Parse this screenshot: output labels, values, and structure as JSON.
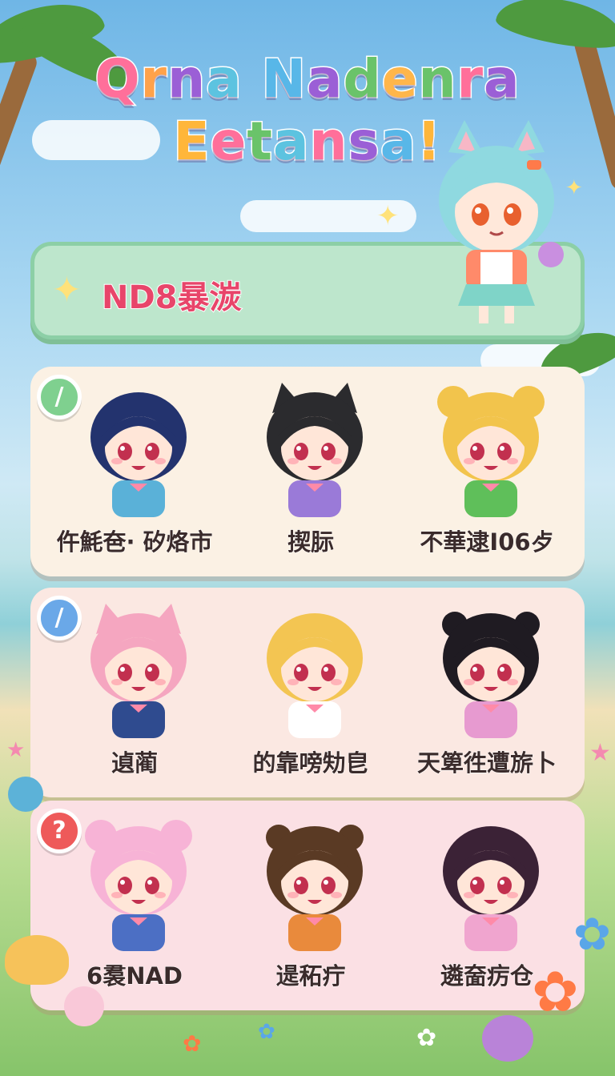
{
  "title": {
    "line1": "Qrna Nadenra",
    "line2": "Eetansa!"
  },
  "title_letters_line1": [
    {
      "ch": "Q",
      "color": "#ff6f9a"
    },
    {
      "ch": "r",
      "color": "#ffa24a"
    },
    {
      "ch": "n",
      "color": "#9b5fd6"
    },
    {
      "ch": "a",
      "color": "#5cc3e0"
    },
    {
      "ch": " ",
      "color": "#fff"
    },
    {
      "ch": "N",
      "color": "#58b7e8"
    },
    {
      "ch": "a",
      "color": "#9b5fd6"
    },
    {
      "ch": "d",
      "color": "#6ac36a"
    },
    {
      "ch": "e",
      "color": "#ffb64a"
    },
    {
      "ch": "n",
      "color": "#6ac36a"
    },
    {
      "ch": "r",
      "color": "#ff6f9a"
    },
    {
      "ch": "a",
      "color": "#9b5fd6"
    }
  ],
  "title_letters_line2": [
    {
      "ch": "E",
      "color": "#ffb63a"
    },
    {
      "ch": "e",
      "color": "#ff6f9a"
    },
    {
      "ch": "t",
      "color": "#6ac36a"
    },
    {
      "ch": "a",
      "color": "#5cc3e0"
    },
    {
      "ch": "n",
      "color": "#ff6f9a"
    },
    {
      "ch": "s",
      "color": "#9b5fd6"
    },
    {
      "ch": "a",
      "color": "#58b7e8"
    },
    {
      "ch": "!",
      "color": "#ffb63a"
    }
  ],
  "banner": {
    "label": "ND8暴湠",
    "icon": "sparkle-icon"
  },
  "panels": [
    {
      "badge_icon": "slash-icon",
      "characters": [
        {
          "name": "仵魹夿· 矽烙市",
          "hair": "#23336e",
          "outfit": "#5ab1d8",
          "ears": "none"
        },
        {
          "name": "揳䏡",
          "hair": "#2b2b2e",
          "outfit": "#9a7ad8",
          "ears": "cat"
        },
        {
          "name": "不華逮I06歺",
          "hair": "#f2c44c",
          "outfit": "#5fbf5a",
          "ears": "bear"
        }
      ]
    },
    {
      "badge_icon": "slash-icon",
      "characters": [
        {
          "name": "遉蔺",
          "hair": "#f5a6c0",
          "outfit": "#2f4b8f",
          "ears": "cat"
        },
        {
          "name": "的靠嗙劮皀",
          "hair": "#f3c552",
          "outfit": "#ffffff",
          "ears": "none"
        },
        {
          "name": "天箄徃遭旂卜",
          "hair": "#1f1b22",
          "outfit": "#e79ad0",
          "ears": "buns"
        }
      ]
    },
    {
      "badge_icon": "question-icon",
      "characters": [
        {
          "name": "6裠NAD",
          "hair": "#f7b3d6",
          "outfit": "#4c6fc4",
          "ears": "bear"
        },
        {
          "name": "遈䄷疔",
          "hair": "#5a3a24",
          "outfit": "#e98a3c",
          "ears": "buns"
        },
        {
          "name": "遴奤疠仓",
          "hair": "#3b2236",
          "outfit": "#f0a5cf",
          "ears": "none"
        }
      ]
    }
  ],
  "colors": {
    "banner_bg": "#bde6cc",
    "banner_text": "#e8456a"
  }
}
